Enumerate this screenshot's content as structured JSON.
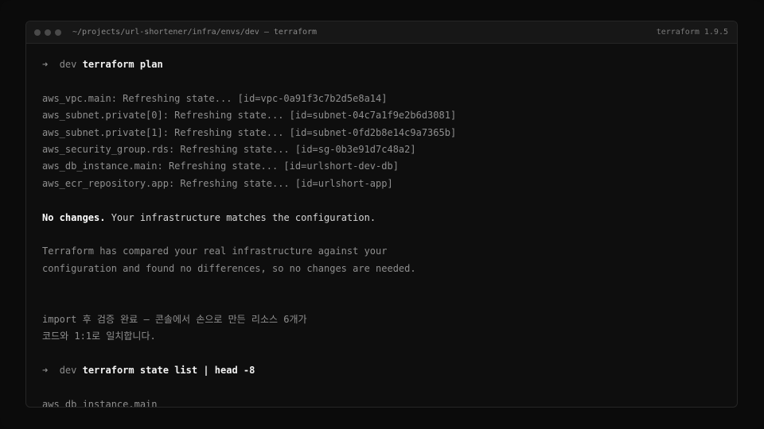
{
  "window": {
    "title": "~/projects/url-shortener/infra/envs/dev — terraform",
    "version": "terraform 1.9.5"
  },
  "prompt1": {
    "arrow": "➜",
    "dir": "dev",
    "command": "terraform plan"
  },
  "refresh_lines": [
    "aws_vpc.main: Refreshing state... [id=vpc-0a91f3c7b2d5e8a14]",
    "aws_subnet.private[0]: Refreshing state... [id=subnet-04c7a1f9e2b6d3081]",
    "aws_subnet.private[1]: Refreshing state... [id=subnet-0fd2b8e14c9a7365b]",
    "aws_security_group.rds: Refreshing state... [id=sg-0b3e91d7c48a2]",
    "aws_db_instance.main: Refreshing state... [id=urlshort-dev-db]",
    "aws_ecr_repository.app: Refreshing state... [id=urlshort-app]"
  ],
  "result": {
    "bold": "No changes.",
    "rest": " Your infrastructure matches the configuration."
  },
  "explanation": [
    "Terraform has compared your real infrastructure against your",
    "configuration and found no differences, so no changes are needed."
  ],
  "note": [
    "import 후 검증 완료 — 콘솔에서 손으로 만든 리소스 6개가",
    "코드와 1:1로 일치합니다."
  ],
  "prompt2": {
    "arrow": "➜",
    "dir": "dev",
    "command": "terraform state list | head -8"
  },
  "state_lines": [
    "aws_db_instance.main"
  ]
}
